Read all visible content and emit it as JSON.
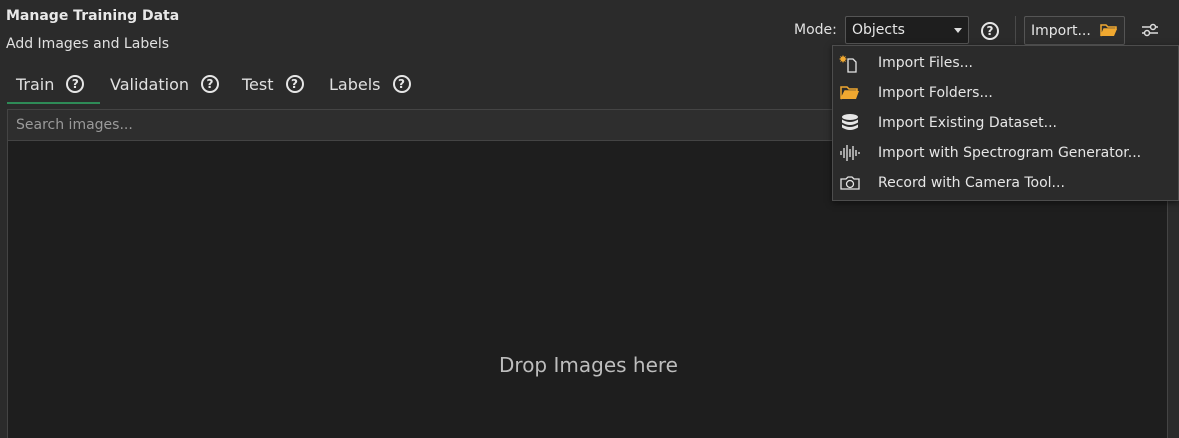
{
  "header": {
    "title": "Manage Training Data",
    "subtitle": "Add Images and Labels"
  },
  "toolbar": {
    "mode_label": "Mode:",
    "mode_value": "Objects",
    "help_glyph": "?",
    "import_label": "Import...",
    "accent_folder_color": "#f0a830"
  },
  "tabs": [
    {
      "label": "Train",
      "selected": true
    },
    {
      "label": "Validation",
      "selected": false
    },
    {
      "label": "Test",
      "selected": false
    },
    {
      "label": "Labels",
      "selected": false
    }
  ],
  "search": {
    "placeholder": "Search images..."
  },
  "dropzone": {
    "text": "Drop Images here"
  },
  "import_menu": {
    "items": [
      {
        "label": "Import Files...",
        "icon": "import-files-icon"
      },
      {
        "label": "Import Folders...",
        "icon": "folder-icon"
      },
      {
        "label": "Import Existing Dataset...",
        "icon": "database-icon"
      },
      {
        "label": "Import with Spectrogram Generator...",
        "icon": "spectrogram-icon"
      },
      {
        "label": "Record with Camera Tool...",
        "icon": "camera-icon"
      }
    ]
  }
}
